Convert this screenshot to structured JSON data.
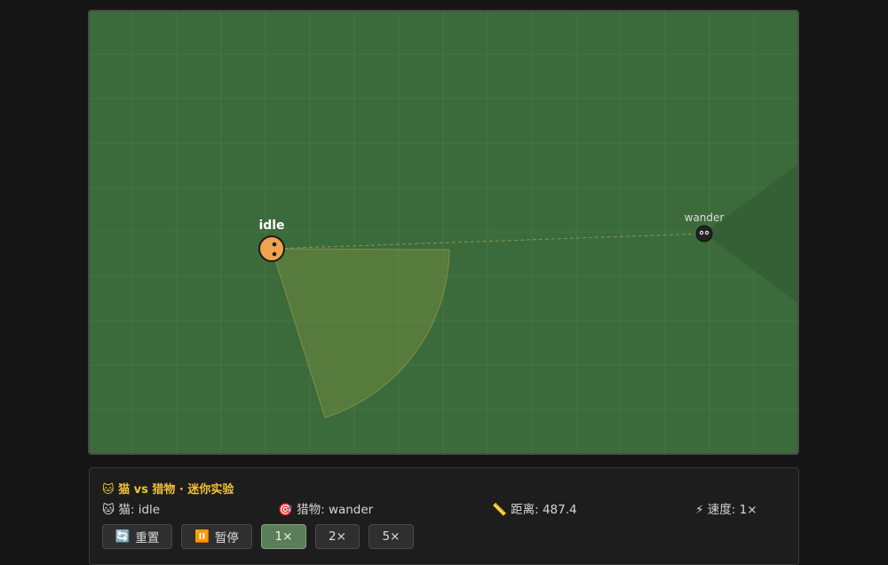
{
  "title": "🐱 猫 vs 猎物 · 迷你实验",
  "stats": {
    "cat": "🐱 猫: idle",
    "prey": "🎯 猎物: wander",
    "distance": "📏 距离: 487.4",
    "speed": "⚡ 速度: 1×"
  },
  "labels": {
    "cat": "idle",
    "prey": "wander"
  },
  "buttons": {
    "reset": {
      "icon": "🔄",
      "label": "重置"
    },
    "pause": {
      "icon": "⏸️",
      "label": "暂停"
    },
    "speed1": "1×",
    "speed2": "2×",
    "speed5": "5×"
  },
  "active_speed": "1×",
  "colors": {
    "field": "#3c6b3b",
    "cat": "#f0a24f",
    "prey": "#222222",
    "accent": "#f1c232",
    "active_button": "#5b7d58"
  }
}
